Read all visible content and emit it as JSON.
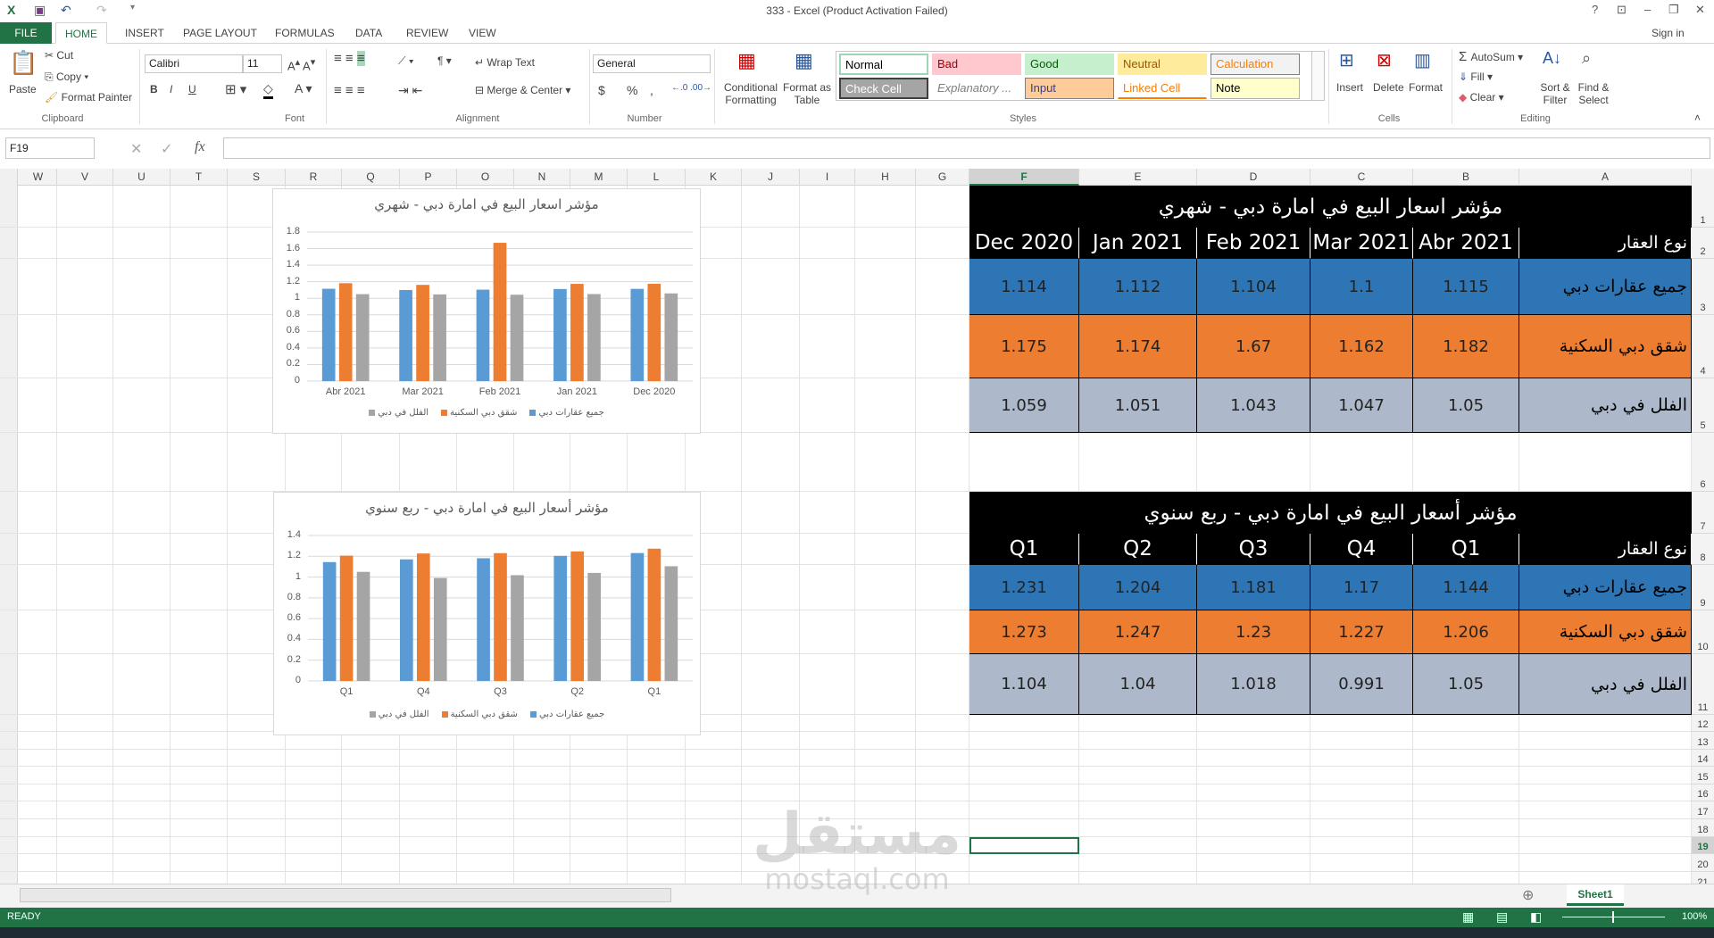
{
  "window": {
    "title": "333 - Excel (Product Activation Failed)",
    "sign_in": "Sign in",
    "help": "?",
    "minimize": "–",
    "restore": "❐",
    "close": "✕"
  },
  "tabs": [
    "FILE",
    "HOME",
    "INSERT",
    "PAGE LAYOUT",
    "FORMULAS",
    "DATA",
    "REVIEW",
    "VIEW"
  ],
  "active_tab": "HOME",
  "ribbon": {
    "clipboard": {
      "label": "Clipboard",
      "paste": "Paste",
      "cut": "Cut",
      "copy": "Copy",
      "format_painter": "Format Painter"
    },
    "font": {
      "label": "Font",
      "name": "Calibri",
      "size": "11",
      "bold": "B",
      "italic": "I",
      "underline": "U"
    },
    "alignment": {
      "label": "Alignment",
      "wrap_text": "Wrap Text",
      "merge_center": "Merge & Center"
    },
    "number": {
      "label": "Number",
      "format": "General",
      "currency": "$",
      "percent": "%",
      "comma": ","
    },
    "styles": {
      "label": "Styles",
      "conditional": "Conditional Formatting",
      "format_table": "Format as Table",
      "cells": [
        {
          "name": "Normal",
          "bg": "#ffffff",
          "fg": "#000000",
          "border": "#9fd5b7"
        },
        {
          "name": "Bad",
          "bg": "#ffc7ce",
          "fg": "#9c0006",
          "border": "#ffc7ce"
        },
        {
          "name": "Good",
          "bg": "#c6efce",
          "fg": "#006100",
          "border": "#c6efce"
        },
        {
          "name": "Neutral",
          "bg": "#ffeb9c",
          "fg": "#9c5700",
          "border": "#ffeb9c"
        },
        {
          "name": "Calculation",
          "bg": "#f2f2f2",
          "fg": "#fa7d00",
          "border": "#7f7f7f"
        },
        {
          "name": "Check Cell",
          "bg": "#a5a5a5",
          "fg": "#ffffff",
          "border": "#3f3f3f"
        },
        {
          "name": "Explanatory ...",
          "bg": "#ffffff",
          "fg": "#7f7f7f",
          "border": "#ffffff"
        },
        {
          "name": "Input",
          "bg": "#ffcc99",
          "fg": "#3f3f76",
          "border": "#7f7f7f"
        },
        {
          "name": "Linked Cell",
          "bg": "#ffffff",
          "fg": "#fa7d00",
          "border": "#ffffff"
        },
        {
          "name": "Note",
          "bg": "#ffffcc",
          "fg": "#000000",
          "border": "#b2b2b2"
        }
      ]
    },
    "cells": {
      "label": "Cells",
      "insert": "Insert",
      "delete": "Delete",
      "format": "Format"
    },
    "editing": {
      "label": "Editing",
      "autosum": "AutoSum",
      "fill": "Fill",
      "clear": "Clear",
      "sort_filter": "Sort & Filter",
      "find_select": "Find & Select"
    }
  },
  "formula_bar": {
    "name_box": "F19",
    "cancel": "✕",
    "enter": "✓",
    "fx": "fx",
    "value": ""
  },
  "columns": [
    "W",
    "V",
    "U",
    "T",
    "S",
    "R",
    "Q",
    "P",
    "O",
    "N",
    "M",
    "L",
    "K",
    "J",
    "I",
    "H",
    "G",
    "F",
    "E",
    "D",
    "C",
    "B",
    "A"
  ],
  "selected_column": "F",
  "rows": [
    "1",
    "2",
    "3",
    "4",
    "5",
    "6",
    "7",
    "8",
    "9",
    "10",
    "11",
    "12",
    "13",
    "14",
    "15",
    "16",
    "17",
    "18",
    "19",
    "20",
    "21"
  ],
  "selected_row": "19",
  "selected_cell": "F19",
  "colors": {
    "blue": "#2e75b6",
    "orange": "#ed7d31",
    "gray": "#adb9ca",
    "chart_blue": "#5b9bd5",
    "chart_orange": "#ed7d31",
    "chart_gray": "#a5a5a5",
    "excel_green": "#217346"
  },
  "monthly_table": {
    "title": "مؤشر اسعار البيع في امارة دبي - شهري",
    "label_header": "نوع العقار",
    "headers": [
      "Abr 2021",
      "Mar 2021",
      "Feb 2021",
      "Jan 2021",
      "Dec 2020"
    ],
    "rows": [
      {
        "label": "جميع عقارات دبي",
        "values": [
          "1.115",
          "1.1",
          "1.104",
          "1.112",
          "1.114"
        ]
      },
      {
        "label": "شقق دبي السكنية",
        "values": [
          "1.182",
          "1.162",
          "1.67",
          "1.174",
          "1.175"
        ]
      },
      {
        "label": "الفلل في دبي",
        "values": [
          "1.05",
          "1.047",
          "1.043",
          "1.051",
          "1.059"
        ]
      }
    ]
  },
  "quarterly_table": {
    "title": "مؤشر أسعار البيع في امارة دبي - ربع سنوي",
    "label_header": "نوع العقار",
    "headers": [
      "Q1",
      "Q4",
      "Q3",
      "Q2",
      "Q1"
    ],
    "rows": [
      {
        "label": "جميع عقارات دبي",
        "values": [
          "1.144",
          "1.17",
          "1.181",
          "1.204",
          "1.231"
        ]
      },
      {
        "label": "شقق دبي السكنية",
        "values": [
          "1.206",
          "1.227",
          "1.23",
          "1.247",
          "1.273"
        ]
      },
      {
        "label": "الفلل في دبي",
        "values": [
          "1.05",
          "0.991",
          "1.018",
          "1.04",
          "1.104"
        ]
      }
    ]
  },
  "chart_data": [
    {
      "type": "bar",
      "title": "مؤشر اسعار البيع في امارة دبي - شهري",
      "categories": [
        "Abr 2021",
        "Mar 2021",
        "Feb 2021",
        "Jan 2021",
        "Dec 2020"
      ],
      "series": [
        {
          "name": "جميع عقارات دبي",
          "color": "#5b9bd5",
          "values": [
            1.115,
            1.1,
            1.104,
            1.112,
            1.114
          ]
        },
        {
          "name": "شقق دبي السكنية",
          "color": "#ed7d31",
          "values": [
            1.182,
            1.162,
            1.67,
            1.174,
            1.175
          ]
        },
        {
          "name": "الفلل في دبي",
          "color": "#a5a5a5",
          "values": [
            1.05,
            1.047,
            1.043,
            1.051,
            1.059
          ]
        }
      ],
      "ylim": [
        0,
        1.8
      ],
      "yticks": [
        "0",
        "0.2",
        "0.4",
        "0.6",
        "0.8",
        "1",
        "1.2",
        "1.4",
        "1.6",
        "1.8"
      ],
      "grid": true,
      "legend": "bottom"
    },
    {
      "type": "bar",
      "title": "مؤشر أسعار البيع في امارة دبي - ربع سنوي",
      "categories": [
        "Q1",
        "Q4",
        "Q3",
        "Q2",
        "Q1"
      ],
      "series": [
        {
          "name": "جميع عقارات دبي",
          "color": "#5b9bd5",
          "values": [
            1.144,
            1.17,
            1.181,
            1.204,
            1.231
          ]
        },
        {
          "name": "شقق دبي السكنية",
          "color": "#ed7d31",
          "values": [
            1.206,
            1.227,
            1.23,
            1.247,
            1.273
          ]
        },
        {
          "name": "الفلل في دبي",
          "color": "#a5a5a5",
          "values": [
            1.05,
            0.991,
            1.018,
            1.04,
            1.104
          ]
        }
      ],
      "ylim": [
        0,
        1.4
      ],
      "yticks": [
        "0",
        "0.2",
        "0.4",
        "0.6",
        "0.8",
        "1",
        "1.2",
        "1.4"
      ],
      "grid": true,
      "legend": "bottom"
    }
  ],
  "sheet_tabs": [
    "Sheet1"
  ],
  "status": {
    "ready": "READY",
    "zoom": "100%"
  },
  "watermark": {
    "arabic": "مستقل",
    "latin": "mostaql.com"
  }
}
